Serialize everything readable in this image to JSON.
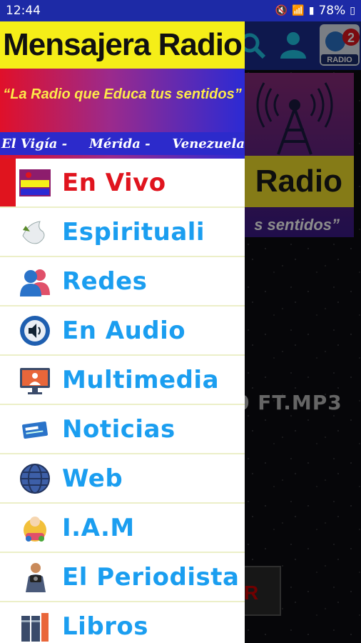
{
  "status_bar": {
    "time": "12:44",
    "battery": "78%"
  },
  "app_bar": {
    "badge_count": "2",
    "radio_label": "RADIO"
  },
  "background": {
    "hero_logo_text": "Radio",
    "hero_slogan": "s sentidos”",
    "track_text": "0 FT.MP3"
  },
  "drawer": {
    "logo_text": "Mensajera Radio",
    "slogan": "“La Radio que Educa tus sentidos”",
    "location": [
      "El Vigía -",
      "Mérida -",
      "Venezuela"
    ],
    "items": [
      {
        "label": "En Vivo",
        "icon": "live-radio-icon",
        "active": true
      },
      {
        "label": "Espirituali",
        "icon": "dove-icon"
      },
      {
        "label": "Redes",
        "icon": "people-icon"
      },
      {
        "label": "En Audio",
        "icon": "speaker-icon"
      },
      {
        "label": "Multimedia",
        "icon": "monitor-icon"
      },
      {
        "label": "Noticias",
        "icon": "news-icon"
      },
      {
        "label": "Web",
        "icon": "globe-icon"
      },
      {
        "label": "I.A.M",
        "icon": "iam-icon"
      },
      {
        "label": "El Periodista",
        "icon": "reporter-icon"
      },
      {
        "label": "Libros",
        "icon": "books-icon"
      }
    ]
  },
  "colors": {
    "active": "#e0141e",
    "menu_text": "#1b9ef0",
    "status_bar": "#1d2aa6"
  }
}
